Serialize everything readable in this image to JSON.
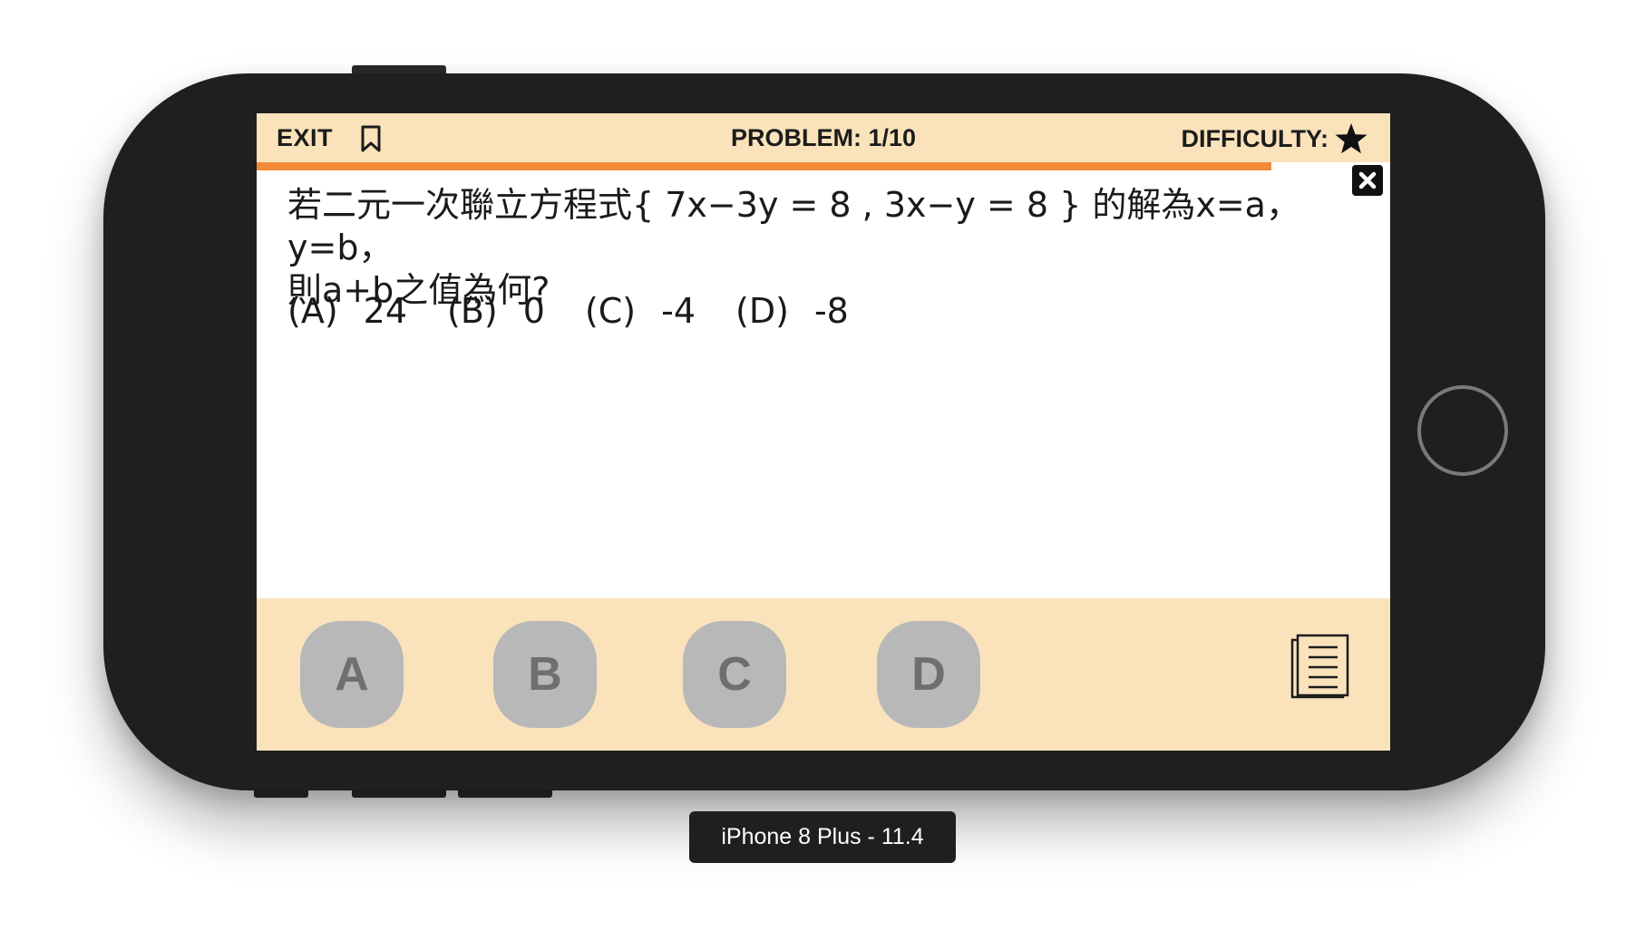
{
  "header": {
    "exit_label": "EXIT",
    "problem_label": "PROBLEM: 1/10",
    "difficulty_label": "DIFFICULTY:",
    "difficulty_stars": 1
  },
  "progress": {
    "value": 0.895,
    "color": "#f38a35"
  },
  "question": {
    "text_line1": "若二元一次聯立方程式{ 7x−3y = 8 , 3x−y = 8 } 的解為x=a，y=b，",
    "text_line2": "則a+b之值為何?"
  },
  "options": [
    {
      "letter": "(A)",
      "value": "24"
    },
    {
      "letter": "(B)",
      "value": "0"
    },
    {
      "letter": "(C)",
      "value": "-4"
    },
    {
      "letter": "(D)",
      "value": "-8"
    }
  ],
  "answer_buttons": [
    "A",
    "B",
    "C",
    "D"
  ],
  "device_label": "iPhone 8 Plus - 11.4",
  "colors": {
    "header_bg": "#fae3bb",
    "answer_bar_bg": "#fae3bb",
    "button_bg": "#b8b8b8",
    "button_text": "#6f6f6f",
    "phone_body": "#1f1f1f"
  },
  "icons": {
    "bookmark": "bookmark-icon",
    "difficulty": "star-icon",
    "close": "close-icon",
    "notes": "notes-icon"
  }
}
